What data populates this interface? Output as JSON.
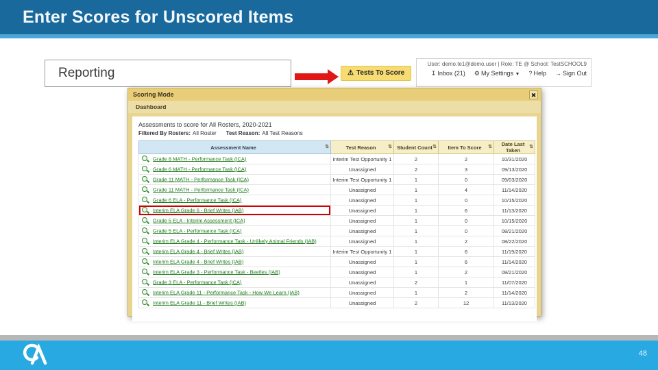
{
  "slide": {
    "title": "Enter Scores for Unscored Items",
    "page_number": "48"
  },
  "icons": {
    "warning": "⚠",
    "inbox": "↧",
    "gear": "⚙",
    "help": "?",
    "signout": "→",
    "dropdown": "▼",
    "close": "✖",
    "sort": "⇅"
  },
  "app_header": {
    "reporting_title": "Reporting",
    "tests_to_score_label": "Tests To Score",
    "user_info": "User: demo.te1@demo.user  |  Role: TE @ School: TestSCHOOL9",
    "toolbar": {
      "inbox_label": "Inbox (21)",
      "settings_label": "My Settings",
      "help_label": "Help",
      "signout_label": "Sign Out"
    }
  },
  "modal": {
    "title": "Scoring Mode",
    "nav_label": "Dashboard",
    "heading": "Assessments to score for All Rosters, 2020-2021",
    "filters": {
      "rosters_label": "Filtered By Rosters:",
      "rosters_value": "All Roster",
      "reason_label": "Test Reason:",
      "reason_value": "All Test Reasons"
    },
    "table": {
      "columns": [
        "Assessment Name",
        "Test Reason",
        "Student Count",
        "Item To Score",
        "Date Last Taken"
      ],
      "rows": [
        {
          "name": "Grade 8 MATH - Performance Task (ICA)",
          "reason": "Interim Test Opportunity 1",
          "students": "2",
          "items": "2",
          "date": "10/31/2020",
          "highlighted": false
        },
        {
          "name": "Grade 6 MATH - Performance Task (ICA)",
          "reason": "Unassigned",
          "students": "2",
          "items": "3",
          "date": "09/13/2020",
          "highlighted": false
        },
        {
          "name": "Grade 11 MATH - Performance Task (ICA)",
          "reason": "Interim Test Opportunity 1",
          "students": "1",
          "items": "0",
          "date": "09/03/2020",
          "highlighted": false
        },
        {
          "name": "Grade 11 MATH - Performance Task (ICA)",
          "reason": "Unassigned",
          "students": "1",
          "items": "4",
          "date": "11/14/2020",
          "highlighted": false
        },
        {
          "name": "Grade 6 ELA - Performance Task (ICA)",
          "reason": "Unassigned",
          "students": "1",
          "items": "0",
          "date": "10/15/2020",
          "highlighted": false
        },
        {
          "name": "Interim ELA Grade 6 - Brief Writes (IAB)",
          "reason": "Unassigned",
          "students": "1",
          "items": "6",
          "date": "11/13/2020",
          "highlighted": true
        },
        {
          "name": "Grade 5 ELA - Interim Assessment (ICA)",
          "reason": "Unassigned",
          "students": "1",
          "items": "0",
          "date": "10/15/2020",
          "highlighted": false
        },
        {
          "name": "Grade 5 ELA - Performance Task (ICA)",
          "reason": "Unassigned",
          "students": "1",
          "items": "0",
          "date": "08/21/2020",
          "highlighted": false
        },
        {
          "name": "Interim ELA Grade 4 - Performance Task - Unlikely Animal Friends (IAB)",
          "reason": "Unassigned",
          "students": "1",
          "items": "2",
          "date": "08/22/2020",
          "highlighted": false
        },
        {
          "name": "Interim ELA Grade 4 - Brief Writes (IAB)",
          "reason": "Interim Test Opportunity 1",
          "students": "1",
          "items": "6",
          "date": "11/19/2020",
          "highlighted": false
        },
        {
          "name": "Interim ELA Grade 4 - Brief Writes (IAB)",
          "reason": "Unassigned",
          "students": "1",
          "items": "6",
          "date": "11/14/2020",
          "highlighted": false
        },
        {
          "name": "Interim ELA Grade 3 - Performance Task - Beetles (IAB)",
          "reason": "Unassigned",
          "students": "1",
          "items": "2",
          "date": "08/21/2020",
          "highlighted": false
        },
        {
          "name": "Grade 3 ELA - Performance Task (ICA)",
          "reason": "Unassigned",
          "students": "2",
          "items": "1",
          "date": "11/07/2020",
          "highlighted": false
        },
        {
          "name": "Interim ELA Grade 11 - Performance Task - How We Learn (IAB)",
          "reason": "Unassigned",
          "students": "1",
          "items": "2",
          "date": "11/14/2020",
          "highlighted": false
        },
        {
          "name": "Interim ELA Grade 11 - Brief Writes (IAB)",
          "reason": "Unassigned",
          "students": "2",
          "items": "12",
          "date": "11/13/2020",
          "highlighted": false
        }
      ]
    }
  },
  "colors": {
    "slide_header_blue": "#19699c",
    "slide_accent_blue": "#4aa6d6",
    "footer_blue": "#29a9e1",
    "modal_tan": "#e8d591",
    "button_yellow": "#f7dc74",
    "highlight_red": "#d40000",
    "link_green": "#1e7b1e"
  }
}
